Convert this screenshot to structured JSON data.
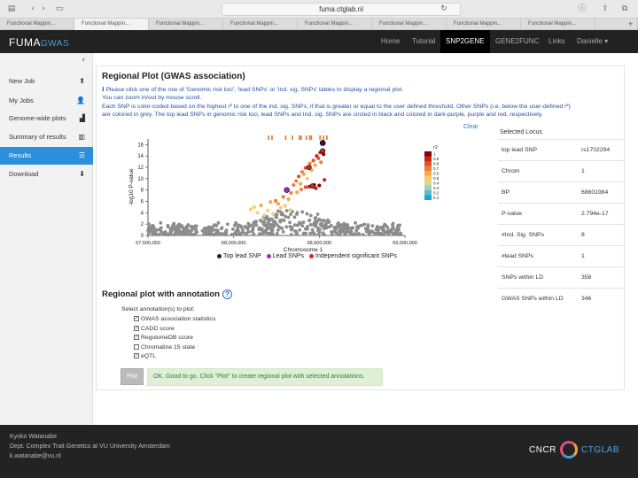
{
  "browser": {
    "url": "fuma.ctglab.nl",
    "tab_label": "Functional Mappin...",
    "tab_count": 8
  },
  "topnav": {
    "logo_main": "FUMA",
    "logo_accent": "GWAS",
    "links": [
      "Home",
      "Tutorial",
      "SNP2GENE",
      "GENE2FUNC",
      "Links",
      "Danielle ▾"
    ],
    "active_index": 2
  },
  "sidebar": {
    "collapse_glyph": "‹",
    "items": [
      {
        "label": "New Job",
        "icon": "⬆"
      },
      {
        "label": "My Jobs",
        "icon": "👤"
      },
      {
        "label": "Genome-wide plots",
        "icon": "▟"
      },
      {
        "label": "Summary of results",
        "icon": "▥"
      },
      {
        "label": "Results",
        "icon": "☰"
      },
      {
        "label": "Download",
        "icon": "⬇"
      }
    ],
    "active_index": 4
  },
  "main": {
    "title": "Regional Plot (GWAS association)",
    "desc": [
      "ℹ Please click one of the row of 'Genomic risk loci', 'lead SNPs' or 'Ind. sig. SNPs' tables to display a regional plot.",
      "You can zoom in/out by mouse scroll.",
      "Each SNP is color-coded based on the highest r² to one of the ind. sig. SNPs, if that is greater or equal to the user defined threshold. Other SNPs (i.e. below the user-defined r²)",
      "are colored in grey. The top lead SNPs in genomic risk loci, lead SNPs and Ind. sig. SNPs are circled in black and colored in dark-purple, purple and red, respectively."
    ],
    "clear_label": "Clear"
  },
  "chart_data": {
    "type": "scatter",
    "title": "",
    "xlabel": "Chromosome 1",
    "ylabel": "-log10 P-value",
    "xlim": [
      67500000,
      69000000
    ],
    "ylim": [
      0,
      17
    ],
    "xticks": [
      "67,500,000",
      "68,000,000",
      "68,500,000",
      "69,000,000"
    ],
    "xtick_values": [
      67500000,
      68000000,
      68500000,
      69000000
    ],
    "yticks": [
      "0",
      "2",
      "4",
      "6",
      "8",
      "10",
      "12",
      "14",
      "16"
    ],
    "ytick_values": [
      0,
      2,
      4,
      6,
      8,
      10,
      12,
      14,
      16
    ],
    "r2_legend": {
      "title": "r2",
      "labels": [
        "1",
        "0.9",
        "0.8",
        "0.7",
        "0.6",
        "0.5",
        "0.4",
        "0.3",
        "0.2",
        "0.1"
      ],
      "colors": [
        "#8b0000",
        "#c0281c",
        "#e0502a",
        "#f07e34",
        "#f6a74a",
        "#f9cd6a",
        "#d9d89a",
        "#9fd3b6",
        "#52bfd0",
        "#1fa3cc"
      ]
    },
    "legend": [
      "Top lead SNP",
      "Lead SNPs",
      "Independent significant SNPs"
    ],
    "legend_colors": [
      "#4a0d3a",
      "#9b30b8",
      "#d42a2a"
    ],
    "background_color": "#8c8c8c",
    "top_lead": {
      "x": 68520000,
      "y": 16.3
    },
    "lead": [
      {
        "x": 68310000,
        "y": 8.0
      }
    ],
    "independent": [
      {
        "x": 68440000,
        "y": 12.0
      },
      {
        "x": 68520000,
        "y": 14.9
      },
      {
        "x": 68460000,
        "y": 8.7
      }
    ],
    "ld_points": [
      {
        "x": 68100000,
        "y": 4.6,
        "c": 5
      },
      {
        "x": 68120000,
        "y": 5.0,
        "c": 5
      },
      {
        "x": 68140000,
        "y": 4.0,
        "c": 6
      },
      {
        "x": 68160000,
        "y": 5.3,
        "c": 4
      },
      {
        "x": 68180000,
        "y": 3.6,
        "c": 6
      },
      {
        "x": 68200000,
        "y": 4.4,
        "c": 5
      },
      {
        "x": 68215000,
        "y": 5.9,
        "c": 4
      },
      {
        "x": 68230000,
        "y": 3.8,
        "c": 6
      },
      {
        "x": 68245000,
        "y": 6.1,
        "c": 3
      },
      {
        "x": 68260000,
        "y": 5.6,
        "c": 4
      },
      {
        "x": 68275000,
        "y": 4.9,
        "c": 5
      },
      {
        "x": 68290000,
        "y": 6.8,
        "c": 3
      },
      {
        "x": 68300000,
        "y": 5.2,
        "c": 5
      },
      {
        "x": 68320000,
        "y": 6.4,
        "c": 4
      },
      {
        "x": 68335000,
        "y": 7.5,
        "c": 3
      },
      {
        "x": 68350000,
        "y": 8.9,
        "c": 3
      },
      {
        "x": 68365000,
        "y": 9.6,
        "c": 3
      },
      {
        "x": 68380000,
        "y": 10.4,
        "c": 2
      },
      {
        "x": 68390000,
        "y": 9.1,
        "c": 4
      },
      {
        "x": 68400000,
        "y": 11.2,
        "c": 3
      },
      {
        "x": 68410000,
        "y": 10.8,
        "c": 4
      },
      {
        "x": 68420000,
        "y": 11.9,
        "c": 2
      },
      {
        "x": 68430000,
        "y": 10.0,
        "c": 5
      },
      {
        "x": 68445000,
        "y": 12.7,
        "c": 3
      },
      {
        "x": 68455000,
        "y": 11.5,
        "c": 4
      },
      {
        "x": 68465000,
        "y": 13.2,
        "c": 2
      },
      {
        "x": 68475000,
        "y": 12.4,
        "c": 4
      },
      {
        "x": 68485000,
        "y": 14.0,
        "c": 1
      },
      {
        "x": 68495000,
        "y": 13.6,
        "c": 2
      },
      {
        "x": 68505000,
        "y": 14.6,
        "c": 1
      },
      {
        "x": 68510000,
        "y": 12.9,
        "c": 3
      },
      {
        "x": 68525000,
        "y": 14.3,
        "c": 0
      },
      {
        "x": 68530000,
        "y": 9.8,
        "c": 1
      },
      {
        "x": 68420000,
        "y": 8.5,
        "c": 2
      },
      {
        "x": 68440000,
        "y": 8.6,
        "c": 1
      },
      {
        "x": 68470000,
        "y": 8.9,
        "c": 0
      },
      {
        "x": 68480000,
        "y": 8.3,
        "c": 1
      },
      {
        "x": 68500000,
        "y": 8.8,
        "c": 0
      },
      {
        "x": 68395000,
        "y": 8.1,
        "c": 3
      },
      {
        "x": 68370000,
        "y": 7.6,
        "c": 4
      },
      {
        "x": 68170000,
        "y": 2.9,
        "c": 7
      },
      {
        "x": 68330000,
        "y": 4.5,
        "c": 6
      }
    ],
    "gene_ticks_x": [
      68200000,
      68220000,
      68300000,
      68340000,
      68380000,
      68390000,
      68420000,
      68440000,
      68450000,
      68500000,
      68520000,
      68540000
    ]
  },
  "locus": {
    "title": "Selected Locus",
    "rows": [
      {
        "k": "top lead SNP",
        "v": "rs1702294"
      },
      {
        "k": "Chrom",
        "v": "1"
      },
      {
        "k": "BP",
        "v": "68601984"
      },
      {
        "k": "P-value",
        "v": "2.794e-17"
      },
      {
        "k": "#Ind. Sig. SNPs",
        "v": "8"
      },
      {
        "k": "#lead SNPs",
        "v": "1"
      },
      {
        "k": "SNPs within LD",
        "v": "358"
      },
      {
        "k": "GWAS SNPs within LD",
        "v": "346"
      }
    ]
  },
  "annotation": {
    "title": "Regional plot with annotation",
    "help": "?",
    "select_label": "Select annotation(s) to plot:",
    "options": [
      {
        "label": "GWAS association statistics",
        "checked": true
      },
      {
        "label": "CADD score",
        "checked": true
      },
      {
        "label": "RegulomeDB score",
        "checked": true
      },
      {
        "label": "Chromatine 15 state",
        "checked": false
      },
      {
        "label": "eQTL",
        "checked": true
      }
    ],
    "plot_button": "Plot",
    "status": "OK. Good to go. Click \"Plot\" to create regional plot with selected annotations."
  },
  "footer": {
    "lines": [
      "Kyoko Watanabe",
      "Dept. Complex Trait Genetics at VU University Amsterdam",
      "k.watanabe@vu.nl"
    ],
    "logo_left": "CNCR",
    "logo_right": "CTGLAB"
  }
}
